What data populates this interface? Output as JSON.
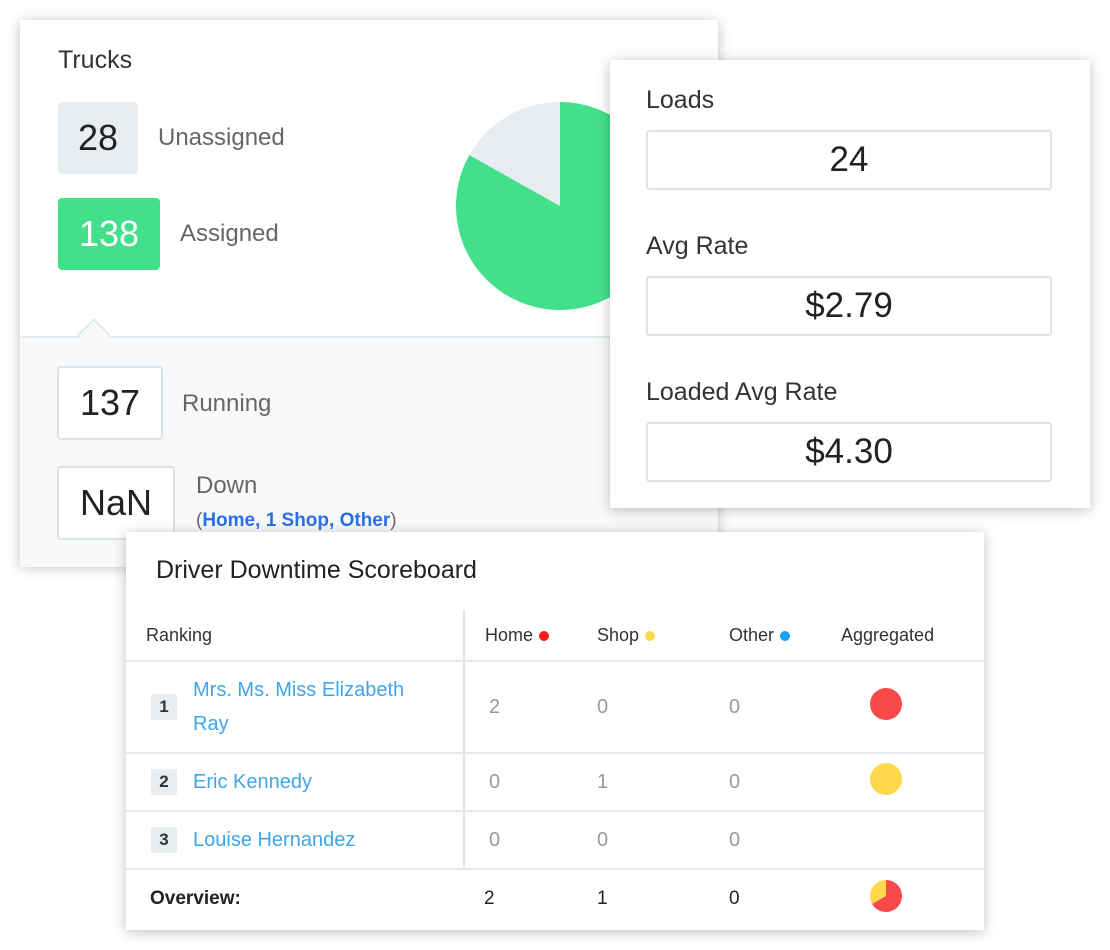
{
  "trucks": {
    "title": "Trucks",
    "unassigned": {
      "value": "28",
      "label": "Unassigned"
    },
    "assigned": {
      "value": "138",
      "label": "Assigned"
    },
    "running": {
      "value": "137",
      "label": "Running"
    },
    "down": {
      "value": "NaN",
      "label": "Down",
      "open": "(",
      "links": [
        "Home",
        "1 Shop",
        "Other"
      ],
      "close": ")"
    },
    "chart_data": {
      "type": "pie",
      "categories": [
        "Unassigned",
        "Assigned"
      ],
      "values": [
        28,
        138
      ],
      "colors": [
        "#e6ecef",
        "#43e08c"
      ]
    }
  },
  "loads": {
    "loads_label": "Loads",
    "loads_value": "24",
    "avg_rate_label": "Avg Rate",
    "avg_rate_value": "$2.79",
    "loaded_avg_rate_label": "Loaded Avg Rate",
    "loaded_avg_rate_value": "$4.30"
  },
  "scoreboard": {
    "title": "Driver Downtime Scoreboard",
    "headers": [
      "Ranking",
      "Home",
      "Shop",
      "Other",
      "Aggregated"
    ],
    "colors": {
      "home": "#ff1a1a",
      "shop": "#ffd84d",
      "other": "#1aa3f0",
      "agg_home": "#f84a4a",
      "agg_shop": "#ffd84d"
    },
    "rows": [
      {
        "rank": "1",
        "name": "Mrs. Ms. Miss Elizabeth Ray",
        "home": "2",
        "shop": "0",
        "other": "0",
        "aggregated": "home"
      },
      {
        "rank": "2",
        "name": "Eric Kennedy",
        "home": "0",
        "shop": "1",
        "other": "0",
        "aggregated": "shop"
      },
      {
        "rank": "3",
        "name": "Louise Hernandez",
        "home": "0",
        "shop": "0",
        "other": "0",
        "aggregated": "none"
      }
    ],
    "overview": {
      "label": "Overview:",
      "home": "2",
      "shop": "1",
      "other": "0"
    }
  }
}
